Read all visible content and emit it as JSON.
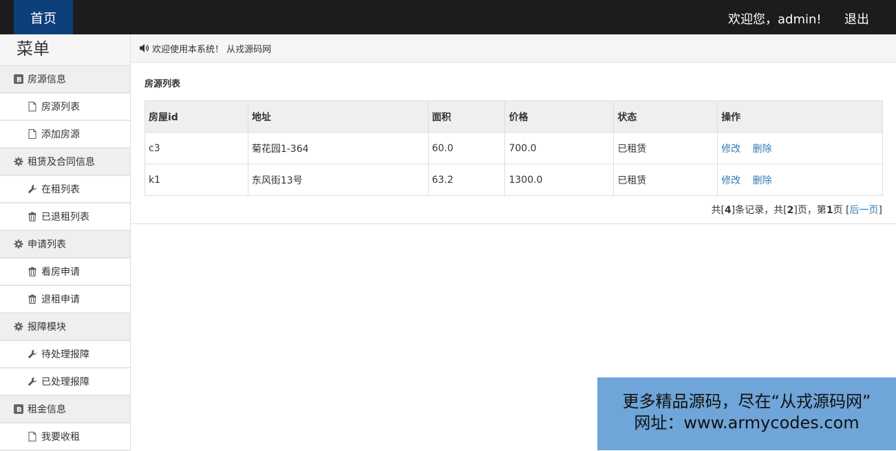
{
  "header": {
    "home_label": "首页",
    "welcome_text": "欢迎您，admin!",
    "logout_label": "退出"
  },
  "sidebar": {
    "title": "菜单",
    "groups": [
      {
        "label": "房源信息",
        "icon": "b-icon",
        "items": [
          {
            "label": "房源列表",
            "icon": "file-icon"
          },
          {
            "label": "添加房源",
            "icon": "file-icon"
          }
        ]
      },
      {
        "label": "租赁及合同信息",
        "icon": "gear-icon",
        "items": [
          {
            "label": "在租列表",
            "icon": "wrench-icon"
          },
          {
            "label": "已退租列表",
            "icon": "trash-icon"
          }
        ]
      },
      {
        "label": "申请列表",
        "icon": "gear-icon",
        "items": [
          {
            "label": "看房申请",
            "icon": "trash-icon"
          },
          {
            "label": "退租申请",
            "icon": "trash-icon"
          }
        ]
      },
      {
        "label": "报障模块",
        "icon": "gear-icon",
        "items": [
          {
            "label": "待处理报障",
            "icon": "wrench-icon"
          },
          {
            "label": "已处理报障",
            "icon": "wrench-icon"
          }
        ]
      },
      {
        "label": "租金信息",
        "icon": "b-icon",
        "items": [
          {
            "label": "我要收租",
            "icon": "file-icon"
          }
        ]
      }
    ]
  },
  "notice": {
    "text": "欢迎使用本系统！ 从戎源码网",
    "icon": "speaker-icon"
  },
  "panel": {
    "title": "房源列表",
    "columns": [
      "房屋id",
      "地址",
      "面积",
      "价格",
      "状态",
      "操作"
    ],
    "rows": [
      {
        "id": "c3",
        "address": "菊花园1-364",
        "area": "60.0",
        "price": "700.0",
        "status": "已租赁",
        "edit": "修改",
        "delete": "删除"
      },
      {
        "id": "k1",
        "address": "东风街13号",
        "area": "63.2",
        "price": "1300.0",
        "status": "已租赁",
        "edit": "修改",
        "delete": "删除"
      }
    ],
    "pager": {
      "p1": "共[",
      "total": "4",
      "p2": "]条记录，共[",
      "pages": "2",
      "p3": "]页，第",
      "current": "1",
      "p4": "页 [",
      "next": "后一页",
      "p5": "]"
    }
  },
  "ad": {
    "line1": "更多精品源码，尽在“从戎源码网”",
    "line2": "网址：www.armycodes.com"
  },
  "colors": {
    "topbar": "#1c1c1c",
    "home": "#0d3f7a",
    "link": "#337ab7",
    "ad": "#6fa5d8"
  }
}
